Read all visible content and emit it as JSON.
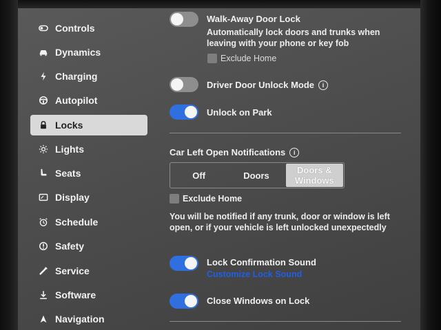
{
  "sidebar": {
    "items": [
      {
        "label": "Controls",
        "icon": "toggle-icon"
      },
      {
        "label": "Dynamics",
        "icon": "car-icon"
      },
      {
        "label": "Charging",
        "icon": "lightning-icon"
      },
      {
        "label": "Autopilot",
        "icon": "steering-wheel-icon"
      },
      {
        "label": "Locks",
        "icon": "lock-icon",
        "active": true
      },
      {
        "label": "Lights",
        "icon": "sun-icon"
      },
      {
        "label": "Seats",
        "icon": "seat-icon"
      },
      {
        "label": "Display",
        "icon": "display-icon"
      },
      {
        "label": "Schedule",
        "icon": "alarm-clock-icon"
      },
      {
        "label": "Safety",
        "icon": "alert-icon"
      },
      {
        "label": "Service",
        "icon": "wrench-icon"
      },
      {
        "label": "Software",
        "icon": "download-icon"
      },
      {
        "label": "Navigation",
        "icon": "navigation-arrow-icon"
      }
    ]
  },
  "walkaway": {
    "label": "Walk-Away Door Lock",
    "description": "Automatically lock doors and trunks when leaving with your phone or key fob",
    "enabled": false,
    "exclude_home_label": "Exclude Home"
  },
  "driver_door": {
    "label": "Driver Door Unlock Mode",
    "enabled": false
  },
  "unlock_on_park": {
    "label": "Unlock on Park",
    "enabled": true
  },
  "notifications": {
    "title": "Car Left Open Notifications",
    "options": [
      "Off",
      "Doors",
      "Doors & Windows"
    ],
    "selected": "Doors & Windows",
    "exclude_home_label": "Exclude Home",
    "description": "You will be notified if any trunk, door or window is left open, or if your vehicle is left unlocked unexpectedly"
  },
  "lock_sound": {
    "label": "Lock Confirmation Sound",
    "link": "Customize Lock Sound",
    "enabled": true
  },
  "close_windows": {
    "label": "Close Windows on Lock",
    "enabled": true
  },
  "colors": {
    "accent": "#2f6fe0",
    "link": "#1f5fe6",
    "active_nav": "#d9d9d9"
  }
}
